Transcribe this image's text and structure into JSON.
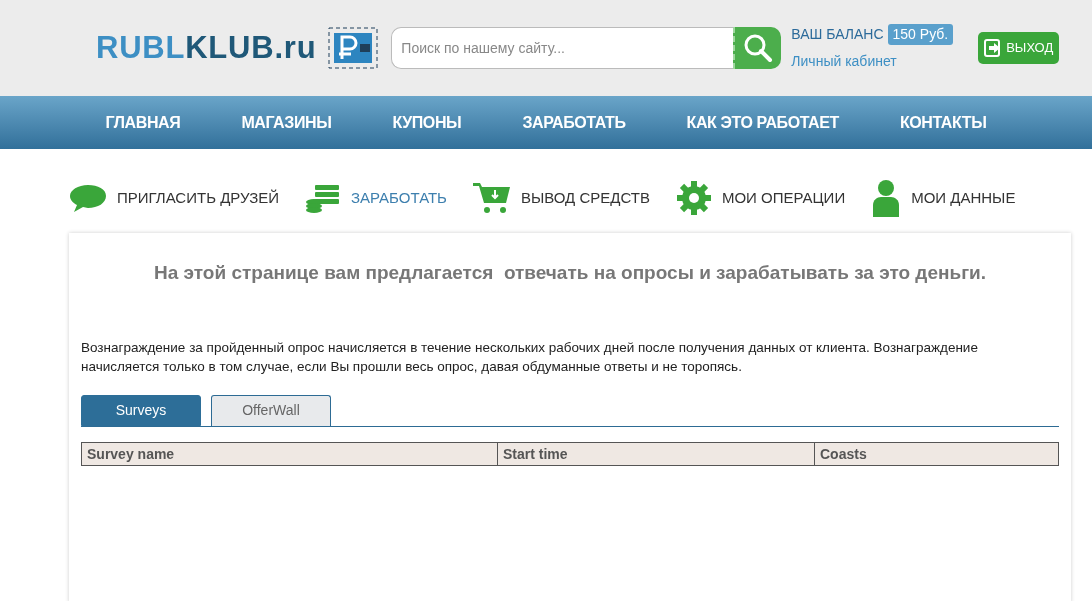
{
  "header": {
    "logo": [
      "RUBL",
      "KLUB.ru"
    ],
    "search": {
      "placeholder": "Поиск по нашему сайту..."
    },
    "balance_label": "ВАШ БАЛАНС",
    "balance": "150 Руб.",
    "account_link": "Личный кабинет",
    "logout": "ВЫХОД"
  },
  "nav": [
    "ГЛАВНАЯ",
    "МАГАЗИНЫ",
    "КУПОНЫ",
    "ЗАРАБОТАТЬ",
    "КАК ЭТО РАБОТАЕТ",
    "КОНТАКТЫ"
  ],
  "account_menu": [
    {
      "kind": "chat",
      "label": "ПРИГЛАСИТЬ ДРУЗЕЙ",
      "selected": false
    },
    {
      "kind": "money",
      "label": "ЗАРАБОТАТЬ",
      "selected": true
    },
    {
      "kind": "cart",
      "label": "ВЫВОД СРЕДСТВ",
      "selected": false
    },
    {
      "kind": "gear",
      "label": "МОИ ОПЕРАЦИИ",
      "selected": false
    },
    {
      "kind": "person",
      "label": "МОИ ДАННЫЕ",
      "selected": false
    }
  ],
  "content": {
    "heading": "На этой странице вам предлагается  отвечать на опросы и зарабатывать за это деньги.",
    "note": "Вознаграждение за пройденный опрос начисляется в течение нескольких рабочих дней после получения данных от клиента. Вознаграждение начисляется только в том случае, если Вы прошли весь опрос, давая обдуманные ответы и не торопясь.",
    "tabs": [
      {
        "label": "Surveys",
        "selected": true
      },
      {
        "label": "OfferWall",
        "selected": false
      }
    ],
    "table": {
      "columns": [
        "Survey name",
        "Start time",
        "Coasts"
      ]
    }
  }
}
